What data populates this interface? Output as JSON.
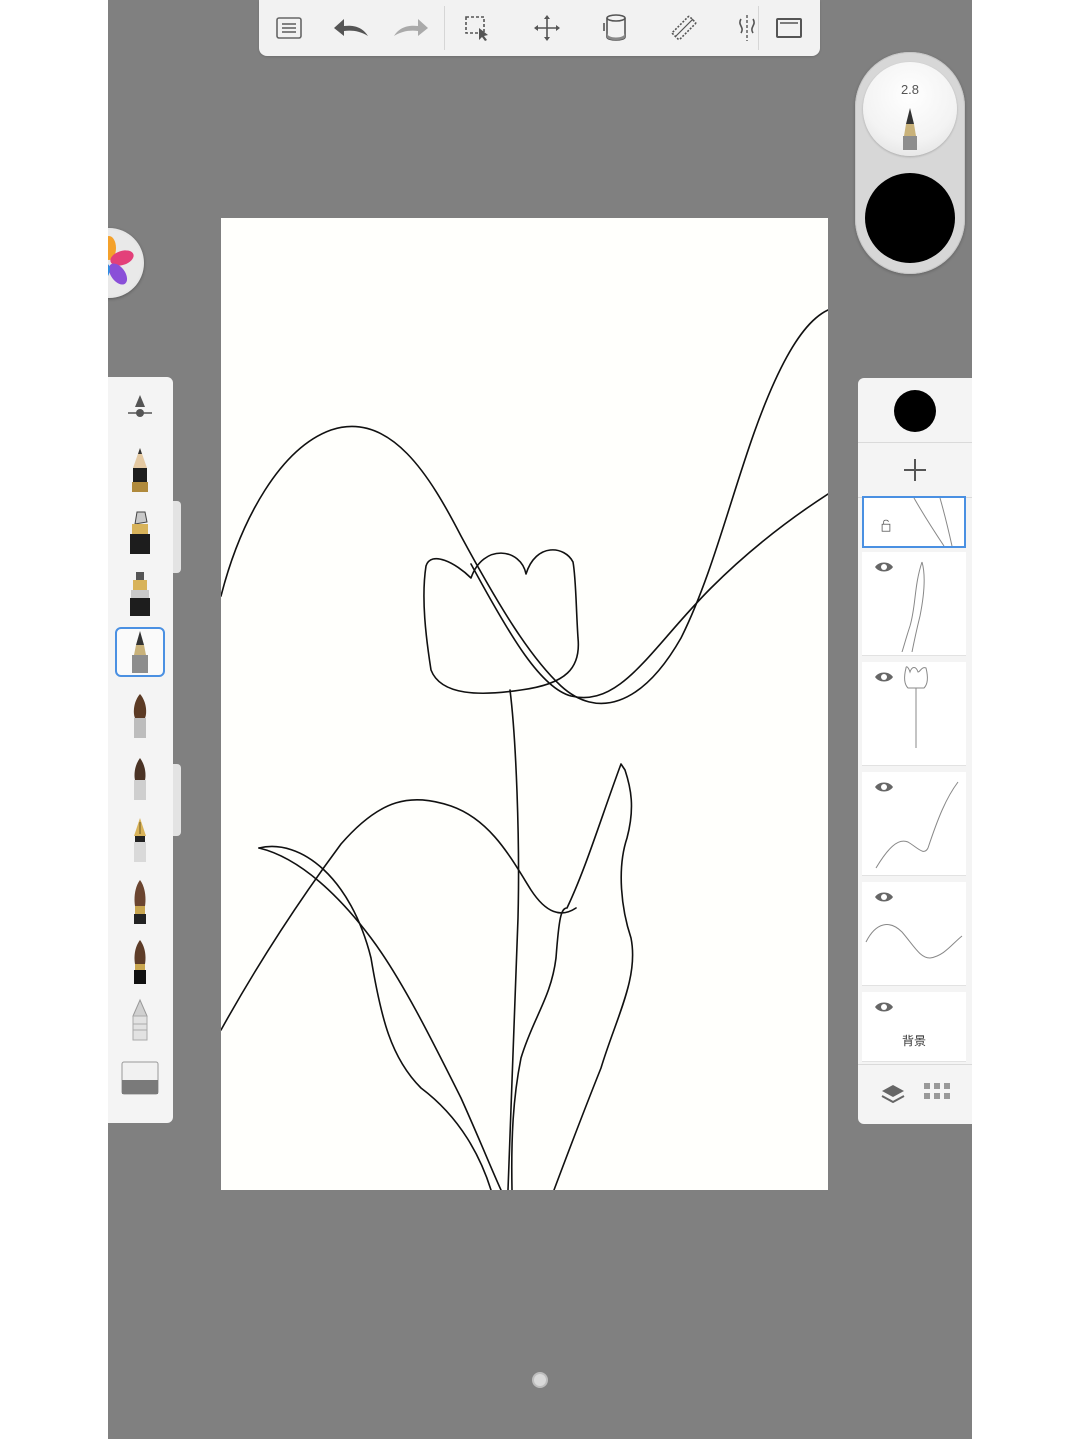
{
  "toolbar": {
    "icons": [
      "list-icon",
      "undo-icon",
      "redo-icon",
      "selection-icon",
      "move-icon",
      "fill-bucket-icon",
      "ruler-icon",
      "symmetry-icon",
      "fullscreen-icon"
    ]
  },
  "brush_puck": {
    "size_value": "2.8",
    "color": "#000000"
  },
  "brush_library": {
    "selected_index": 3,
    "icons": [
      "brush-settings-icon",
      "pencil-icon",
      "marker-icon",
      "pen-icon",
      "ballpoint-pen-icon",
      "paintbrush-icon",
      "airbrush-icon",
      "fountain-pen-icon",
      "flat-brush-icon",
      "ink-brush-icon",
      "smudge-icon",
      "eraser-icon"
    ]
  },
  "layers": {
    "active_color": "#000000",
    "items": [
      {
        "name": "",
        "active": true
      },
      {
        "name": "",
        "visible": true
      },
      {
        "name": "",
        "visible": true
      },
      {
        "name": "",
        "visible": true
      },
      {
        "name": "",
        "visible": true
      },
      {
        "name": "背景",
        "visible": true
      }
    ]
  },
  "colors": {
    "workspace_bg": "#808080",
    "panel_bg": "#f4f4f4",
    "canvas_bg": "#fffffc",
    "selection_accent": "#4a90e2"
  }
}
